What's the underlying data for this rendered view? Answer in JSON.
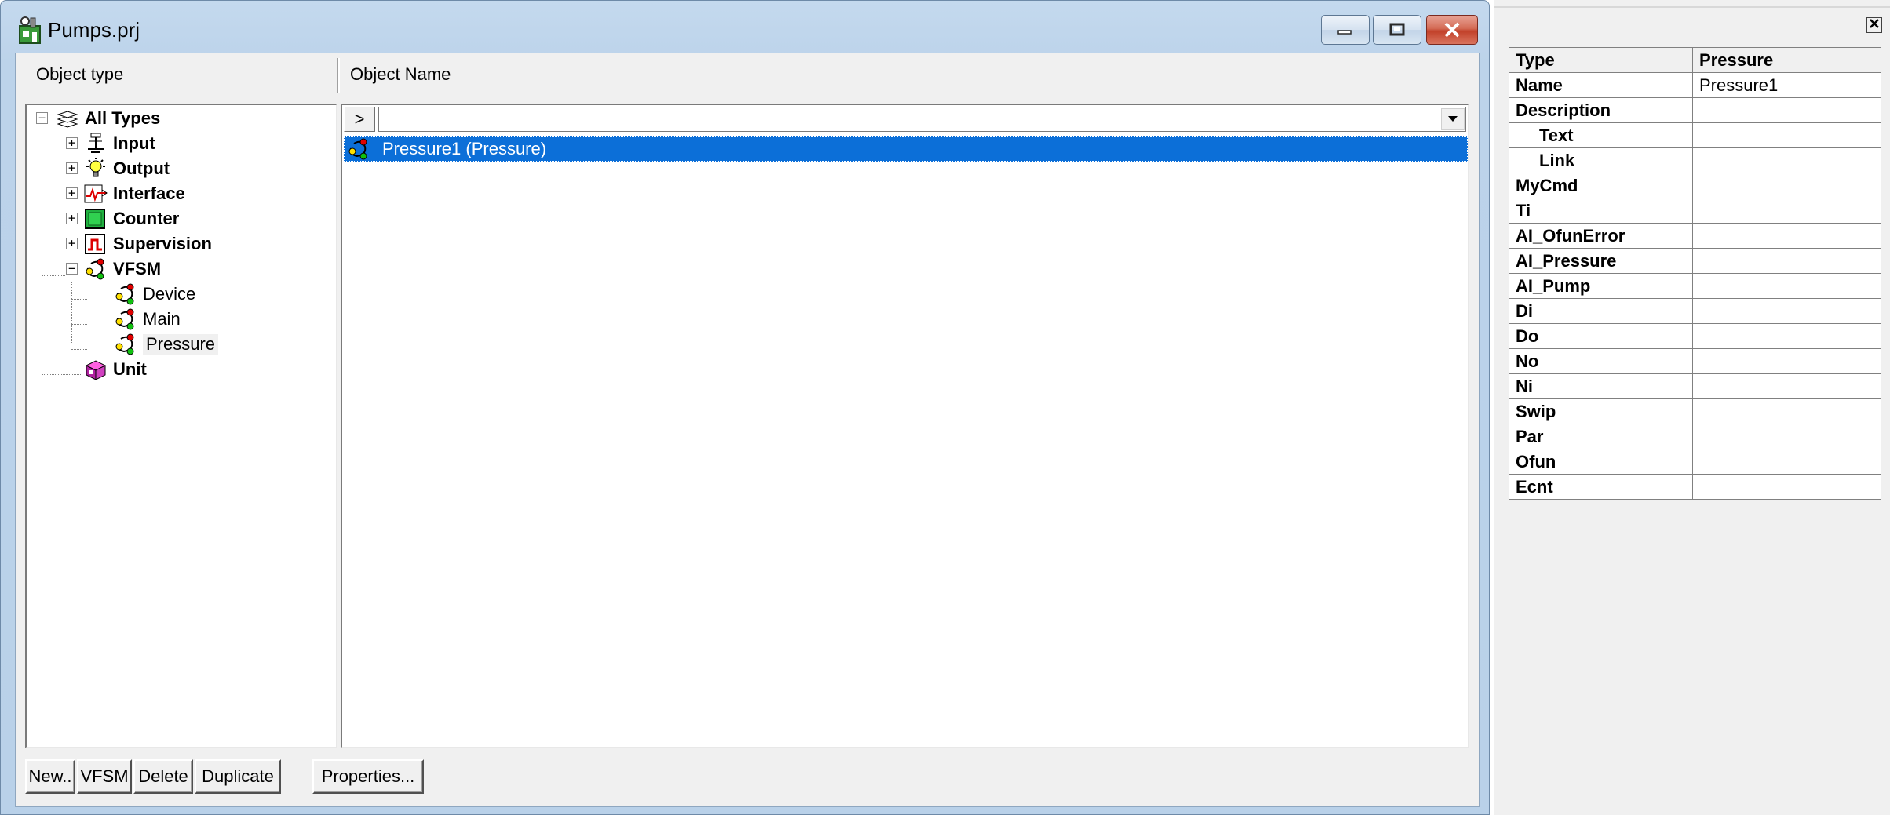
{
  "window": {
    "title": "Pumps.prj",
    "controls": {
      "minimize": "minimize",
      "restore": "restore",
      "close": "close"
    }
  },
  "columns": {
    "object_type": "Object type",
    "object_name": "Object Name"
  },
  "tree": {
    "root": "All Types",
    "items": [
      "Input",
      "Output",
      "Interface",
      "Counter",
      "Supervision",
      "VFSM"
    ],
    "vfsm_children": [
      "Device",
      "Main",
      "Pressure"
    ],
    "last": "Unit",
    "selected": "Pressure"
  },
  "list": {
    "go_label": ">",
    "filter_value": "",
    "rows": [
      "Pressure1 (Pressure)"
    ]
  },
  "buttons": {
    "new": "New..",
    "vfsm": "VFSM",
    "delete": "Delete",
    "duplicate": "Duplicate",
    "properties": "Properties..."
  },
  "panel": {
    "close": "x",
    "header": {
      "key": "Type",
      "value": "Pressure"
    },
    "rows": [
      {
        "key": "Name",
        "value": "Pressure1"
      },
      {
        "key": "Description",
        "value": ""
      },
      {
        "key": "Text",
        "value": ""
      },
      {
        "key": "Link",
        "value": ""
      },
      {
        "key": "MyCmd",
        "value": ""
      },
      {
        "key": "Ti",
        "value": ""
      },
      {
        "key": "AI_OfunError",
        "value": ""
      },
      {
        "key": "AI_Pressure",
        "value": ""
      },
      {
        "key": "AI_Pump",
        "value": ""
      },
      {
        "key": "Di",
        "value": ""
      },
      {
        "key": "Do",
        "value": ""
      },
      {
        "key": "No",
        "value": ""
      },
      {
        "key": "Ni",
        "value": ""
      },
      {
        "key": "Swip",
        "value": ""
      },
      {
        "key": "Par",
        "value": ""
      },
      {
        "key": "Ofun",
        "value": ""
      },
      {
        "key": "Ecnt",
        "value": ""
      }
    ]
  },
  "colors": {
    "selection": "#0c6fd8",
    "titlebar": "#c4d9ee",
    "close_button": "#c2412a"
  }
}
